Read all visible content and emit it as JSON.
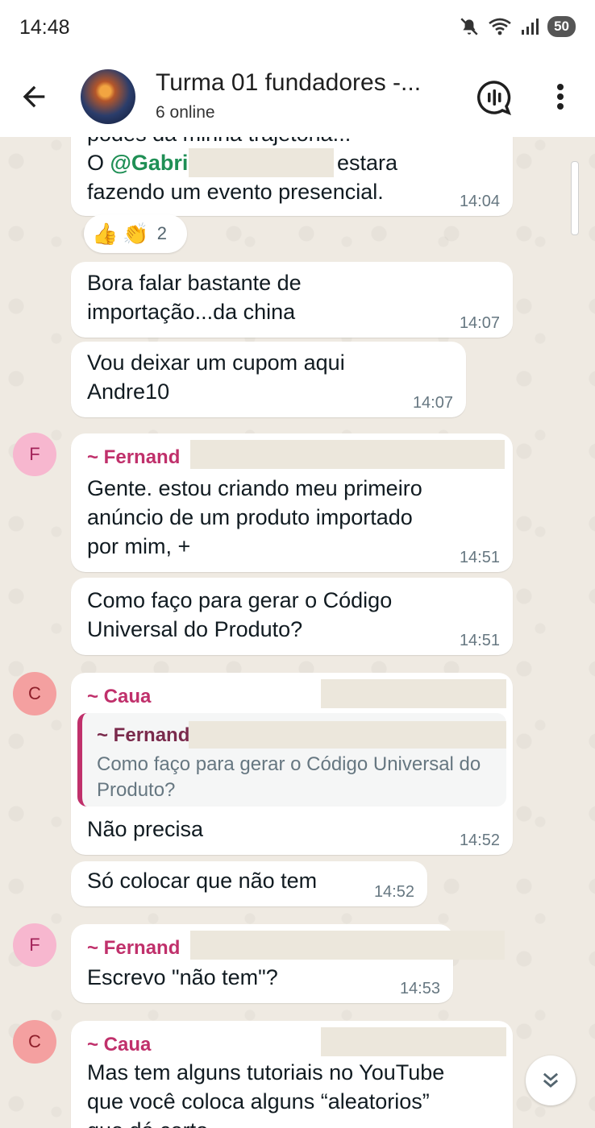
{
  "status_bar": {
    "time": "14:48",
    "battery": "50"
  },
  "header": {
    "title": "Turma 01 fundadores  -...",
    "subtitle": "6 online"
  },
  "messages": {
    "m1": {
      "line_partial": "podes da minha trajetória...",
      "prefix": "O ",
      "mention": "@Gabri",
      "suffix": "estara",
      "line2": "fazendo um evento presencial.",
      "time": "14:04"
    },
    "reactions": {
      "emoji1": "👍",
      "emoji2": "👏",
      "count": "2"
    },
    "m2": {
      "line1": "Bora falar bastante de",
      "line2": "importação...da china",
      "time": "14:07"
    },
    "m3": {
      "line1": "Vou deixar um cupom aqui",
      "line2": "Andre10",
      "time": "14:07"
    },
    "m4": {
      "avatar": "F",
      "sender": "~ Fernand",
      "line1": "Gente. estou criando meu primeiro",
      "line2": "anúncio de um produto importado",
      "line3": "por mim, +",
      "time": "14:51"
    },
    "m5": {
      "line1": "Como faço para gerar o Código",
      "line2": "Universal do Produto?",
      "time": "14:51"
    },
    "m6": {
      "avatar": "C",
      "sender": "~ Caua",
      "quote_sender": "~ Fernand",
      "quote_text": "Como faço para gerar o Código Universal do Produto?",
      "text": "Não precisa",
      "time": "14:52"
    },
    "m7": {
      "text": "Só colocar que não tem",
      "time": "14:52"
    },
    "m8": {
      "avatar": "F",
      "sender": "~ Fernand",
      "text": "Escrevo \"não tem\"?",
      "time": "14:53"
    },
    "m9": {
      "avatar": "C",
      "sender": "~ Caua",
      "line1": "Mas tem alguns tutoriais no YouTube",
      "line2": "que você coloca alguns “aleatorios”",
      "line3": "que dá certo"
    }
  },
  "colors": {
    "sender_name": "#c0306b",
    "mention": "#1f8f55",
    "chat_bg": "#efeae2"
  }
}
